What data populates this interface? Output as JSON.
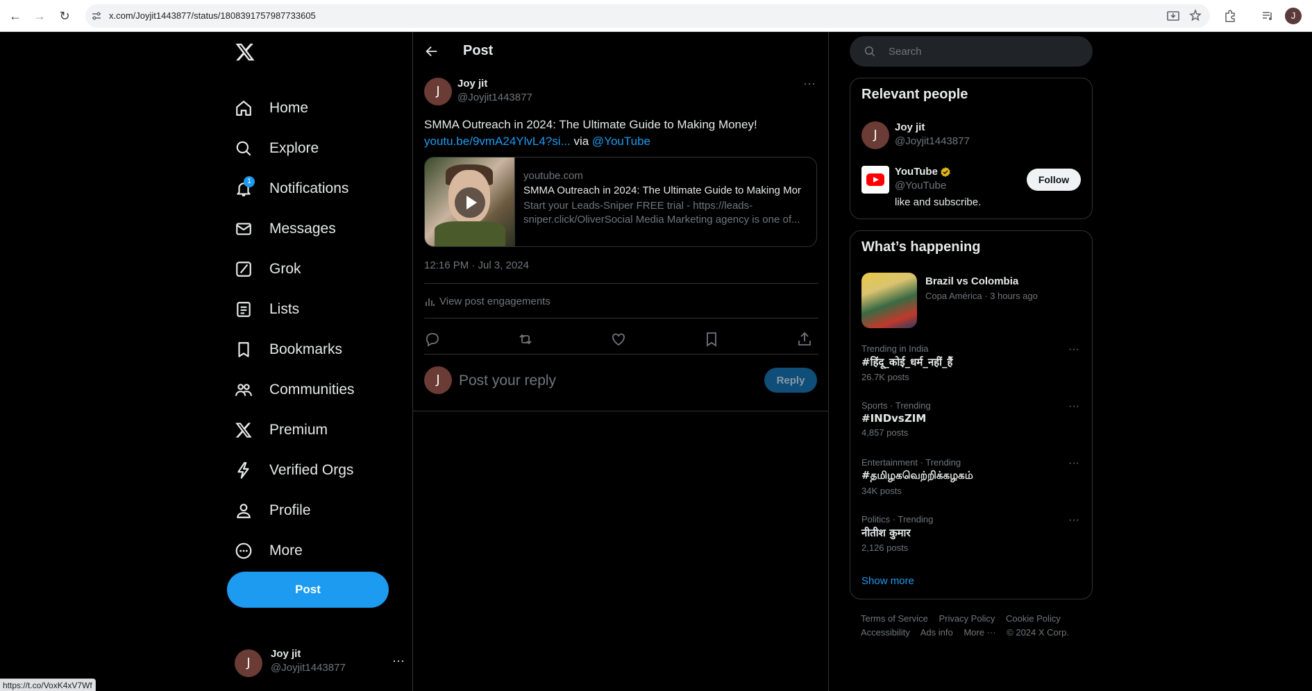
{
  "browser": {
    "url": "x.com/Joyjit1443877/status/1808391757987733605",
    "status_url": "https://t.co/VoxK4xV7Wf",
    "profile_initial": "J"
  },
  "nav": {
    "items": [
      {
        "label": "Home",
        "icon": "home-icon"
      },
      {
        "label": "Explore",
        "icon": "search-icon"
      },
      {
        "label": "Notifications",
        "icon": "bell-icon",
        "badge": "1"
      },
      {
        "label": "Messages",
        "icon": "envelope-icon"
      },
      {
        "label": "Grok",
        "icon": "grok-icon"
      },
      {
        "label": "Lists",
        "icon": "list-icon"
      },
      {
        "label": "Bookmarks",
        "icon": "bookmark-icon"
      },
      {
        "label": "Communities",
        "icon": "people-icon"
      },
      {
        "label": "Premium",
        "icon": "x-logo-icon"
      },
      {
        "label": "Verified Orgs",
        "icon": "lightning-icon"
      },
      {
        "label": "Profile",
        "icon": "person-icon"
      },
      {
        "label": "More",
        "icon": "more-circle-icon"
      }
    ],
    "post_button": "Post",
    "account": {
      "initial": "J",
      "name": "Joy jit",
      "handle": "@Joyjit1443877",
      "more": "···"
    }
  },
  "main": {
    "title": "Post",
    "tweet": {
      "author_initial": "J",
      "author_name": "Joy jit",
      "author_handle": "@Joyjit1443877",
      "more": "···",
      "text": "SMMA Outreach in 2024: The Ultimate Guide to Making Money!",
      "link": "youtu.be/9vmA24YlvL4?si...",
      "via": " via ",
      "mention": "@YouTube",
      "card": {
        "domain": "youtube.com",
        "title": "SMMA Outreach in 2024: The Ultimate Guide to Making Mor",
        "description": "Start your Leads-Sniper FREE trial - https://leads-sniper.click/OliverSocial Media Marketing agency is one of..."
      },
      "timestamp": "12:16 PM · Jul 3, 2024",
      "engagements": "View post engagements"
    },
    "reply": {
      "initial": "J",
      "placeholder": "Post your reply",
      "button": "Reply"
    }
  },
  "sidebar": {
    "search_placeholder": "Search",
    "relevant": {
      "title": "Relevant people",
      "people": [
        {
          "initial": "J",
          "name": "Joy jit",
          "handle": "@Joyjit1443877"
        },
        {
          "name": "YouTube",
          "handle": "@YouTube",
          "bio": "like and subscribe.",
          "follow": "Follow"
        }
      ]
    },
    "happening": {
      "title": "What’s happening",
      "news": {
        "title": "Brazil vs Colombia",
        "meta": "Copa América · 3 hours ago"
      },
      "trends": [
        {
          "meta": "Trending in India",
          "name": "#हिंदू_कोई_धर्म_नहीं_हैं",
          "count": "26.7K posts"
        },
        {
          "meta": "Sports · Trending",
          "name": "#INDvsZIM",
          "count": "4,857 posts"
        },
        {
          "meta": "Entertainment · Trending",
          "name": "#தமிழகவெற்றிக்கழகம்",
          "count": "34K posts"
        },
        {
          "meta": "Politics · Trending",
          "name": "नीतीश कुमार",
          "count": "2,126 posts"
        }
      ],
      "show_more": "Show more"
    },
    "footer": {
      "links": [
        "Terms of Service",
        "Privacy Policy",
        "Cookie Policy",
        "Accessibility",
        "Ads info",
        "More ···",
        "© 2024 X Corp."
      ]
    }
  },
  "colors": {
    "accent": "#1d9bf0",
    "background": "#000000",
    "border": "#2f3336",
    "muted": "#71767b"
  }
}
